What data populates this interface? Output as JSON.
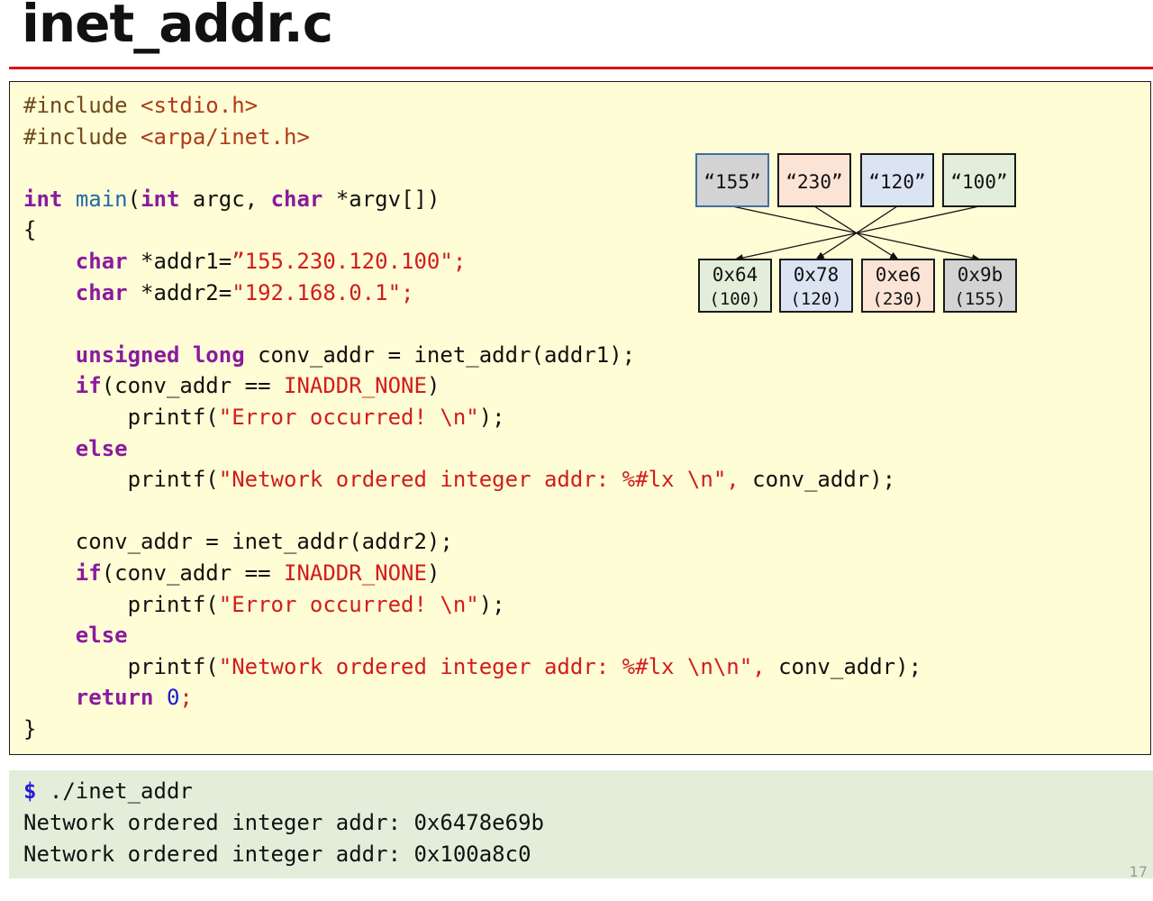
{
  "slide": {
    "title": "inet_addr.c",
    "page_number": "17"
  },
  "code": {
    "lines": [
      [
        [
          "pp",
          "#include "
        ],
        [
          "inc",
          "<stdio.h>"
        ]
      ],
      [
        [
          "pp",
          "#include "
        ],
        [
          "inc",
          "<arpa/inet.h>"
        ]
      ],
      [],
      [
        [
          "kw",
          "int"
        ],
        [
          "plain",
          " "
        ],
        [
          "ty",
          "main"
        ],
        [
          "plain",
          "("
        ],
        [
          "kw",
          "int"
        ],
        [
          "plain",
          " argc, "
        ],
        [
          "kw",
          "char"
        ],
        [
          "plain",
          " *argv[])"
        ]
      ],
      [
        [
          "plain",
          "{"
        ]
      ],
      [
        [
          "plain",
          "    "
        ],
        [
          "kw",
          "char"
        ],
        [
          "plain",
          " *addr1="
        ],
        [
          "str",
          "”155.230.120.100\";"
        ]
      ],
      [
        [
          "plain",
          "    "
        ],
        [
          "kw",
          "char"
        ],
        [
          "plain",
          " *addr2="
        ],
        [
          "str",
          "\"192.168.0.1\";"
        ]
      ],
      [],
      [
        [
          "plain",
          "    "
        ],
        [
          "kw",
          "unsigned long"
        ],
        [
          "plain",
          " conv_addr = inet_addr(addr1);"
        ]
      ],
      [
        [
          "plain",
          "    "
        ],
        [
          "kw",
          "if"
        ],
        [
          "plain",
          "(conv_addr == "
        ],
        [
          "macro",
          "INADDR_NONE"
        ],
        [
          "plain",
          ")"
        ]
      ],
      [
        [
          "plain",
          "        printf("
        ],
        [
          "str",
          "\"Error occurred! \\n\""
        ],
        [
          "plain",
          ");"
        ]
      ],
      [
        [
          "plain",
          "    "
        ],
        [
          "kw",
          "else"
        ]
      ],
      [
        [
          "plain",
          "        printf("
        ],
        [
          "str",
          "\"Network ordered integer addr: %#lx \\n\","
        ],
        [
          "plain",
          " conv_addr);"
        ]
      ],
      [],
      [
        [
          "plain",
          "    conv_addr = inet_addr(addr2);"
        ]
      ],
      [
        [
          "plain",
          "    "
        ],
        [
          "kw",
          "if"
        ],
        [
          "plain",
          "(conv_addr == "
        ],
        [
          "macro",
          "INADDR_NONE"
        ],
        [
          "plain",
          ")"
        ]
      ],
      [
        [
          "plain",
          "        printf("
        ],
        [
          "str",
          "\"Error occurred! \\n\""
        ],
        [
          "plain",
          ");"
        ]
      ],
      [
        [
          "plain",
          "    "
        ],
        [
          "kw",
          "else"
        ]
      ],
      [
        [
          "plain",
          "        printf("
        ],
        [
          "str",
          "\"Network ordered integer addr: %#lx \\n\\n\","
        ],
        [
          "plain",
          " conv_addr);"
        ]
      ],
      [
        [
          "plain",
          "    "
        ],
        [
          "kw",
          "return"
        ],
        [
          "plain",
          " "
        ],
        [
          "num",
          "0"
        ],
        [
          "str",
          ";"
        ]
      ],
      [
        [
          "plain",
          "}"
        ]
      ]
    ]
  },
  "diagram": {
    "top_boxes": [
      {
        "label": "“155”",
        "fill": "#d3d3d3",
        "stroke": "#3f6fa0"
      },
      {
        "label": "“230”",
        "fill": "#fbe4d6",
        "stroke": "#1a1a1a"
      },
      {
        "label": "“120”",
        "fill": "#dbe4f3",
        "stroke": "#1a1a1a"
      },
      {
        "label": "“100”",
        "fill": "#e2eed9",
        "stroke": "#1a1a1a"
      }
    ],
    "bottom_boxes": [
      {
        "hex": "0x64",
        "dec": "(100)",
        "fill": "#e2eed9"
      },
      {
        "hex": "0x78",
        "dec": "(120)",
        "fill": "#dbe4f3"
      },
      {
        "hex": "0xe6",
        "dec": "(230)",
        "fill": "#fbe4d6"
      },
      {
        "hex": "0x9b",
        "dec": "(155)",
        "fill": "#d3d3d3"
      }
    ],
    "mapping": [
      [
        0,
        3
      ],
      [
        1,
        2
      ],
      [
        2,
        1
      ],
      [
        3,
        0
      ]
    ]
  },
  "terminal": {
    "prompt": "$",
    "command": " ./inet_addr",
    "output": [
      "Network ordered integer addr: 0x6478e69b",
      "Network ordered integer addr: 0x100a8c0"
    ]
  },
  "colors": {
    "title_rule": "#e01010",
    "code_background": "#fefdd5",
    "terminal_background": "#e2eed9",
    "keyword": "#8a1aa0",
    "string": "#d21c1c"
  }
}
